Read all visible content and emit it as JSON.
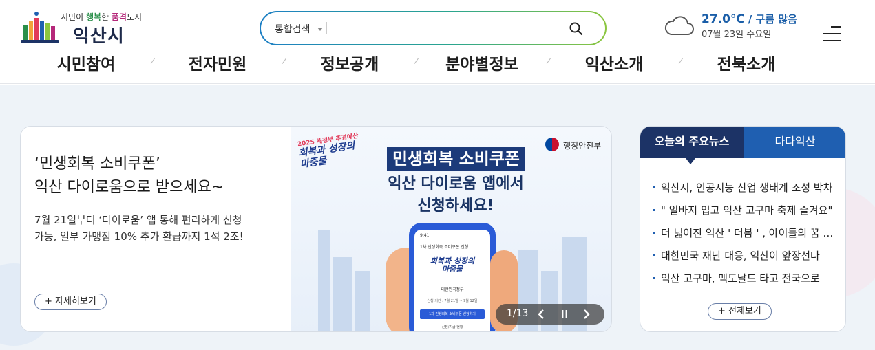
{
  "header": {
    "logo": {
      "slogan_prefix": "시민이 ",
      "slogan_happy": "행복",
      "slogan_mid": "한 ",
      "slogan_pum": "품격",
      "slogan_suffix": "도시",
      "name": "익산시"
    },
    "search": {
      "select_label": "통합검색",
      "placeholder": "",
      "button_icon": "search-icon"
    },
    "weather": {
      "icon": "cloud-icon",
      "temperature": "27.0℃",
      "description": " / 구름 많음",
      "date": "07월 23일 수요일"
    },
    "menu_icon": "hamburger-menu-icon"
  },
  "gnb": {
    "items": [
      {
        "label": "시민참여"
      },
      {
        "label": "전자민원"
      },
      {
        "label": "정보공개"
      },
      {
        "label": "분야별정보"
      },
      {
        "label": "익산소개"
      },
      {
        "label": "전북소개"
      }
    ]
  },
  "slider": {
    "title_line1": "‘민생회복 소비쿠폰’",
    "title_line2": "익산 다이로움으로 받으세요~",
    "desc_line1": "7월 21일부터 ‘다이로움’ 앱 통해 편리하게 신청",
    "desc_line2": "가능, 일부 가맹점 10% 추가 환급까지 1석 2조!",
    "more_label": "+ 자세히보기",
    "image": {
      "gov_label": "행정안전부",
      "badge_small": "2025 새정부 추경예산",
      "badge_line1": "회복과 성장의",
      "badge_line2": "마중물",
      "headline": "민생회복 소비쿠폰",
      "sub_line1": "익산 다이로움 앱에서",
      "sub_line2": "신청하세요!",
      "phone": {
        "time": "9:41",
        "header": "1차 민생회복 소비쿠폰 신청",
        "title_line1": "회복과 성장의",
        "title_line2": "마중물",
        "gov": "대한민국정부",
        "period": "신청 기간 : 7월 21일 ~ 9월 12일",
        "button": "1차 민생회복 소비쿠폰 신청하기",
        "link": "신청/지급 현황"
      }
    },
    "pager": "1/13",
    "controls": {
      "prev_icon": "chevron-left-icon",
      "pause_icon": "pause-icon",
      "next_icon": "chevron-right-icon"
    }
  },
  "news": {
    "tabs": [
      {
        "label": "오늘의 주요뉴스",
        "active": true
      },
      {
        "label": "다다익산",
        "active": false
      }
    ],
    "items": [
      {
        "title": "익산시, 인공지능 산업 생태계 조성 박차"
      },
      {
        "title": " \" 일바지 입고 익산 고구마 축제 즐겨요\""
      },
      {
        "title": "더 넓어진 익산 ' 더봄 ' , 아이들의 꿈 키운다"
      },
      {
        "title": "대한민국 재난 대응, 익산이 앞장선다"
      },
      {
        "title": "익산 고구마, 맥도날드 타고 전국으로"
      }
    ],
    "more_label": "+ 전체보기"
  },
  "colors": {
    "brand_navy": "#1c3366",
    "brand_blue": "#1f5fb1",
    "weather_blue": "#1a5ea8",
    "search_gradient_start": "#1d7fc4",
    "search_gradient_end": "#8cc63f",
    "page_bg": "#eef3f8"
  }
}
